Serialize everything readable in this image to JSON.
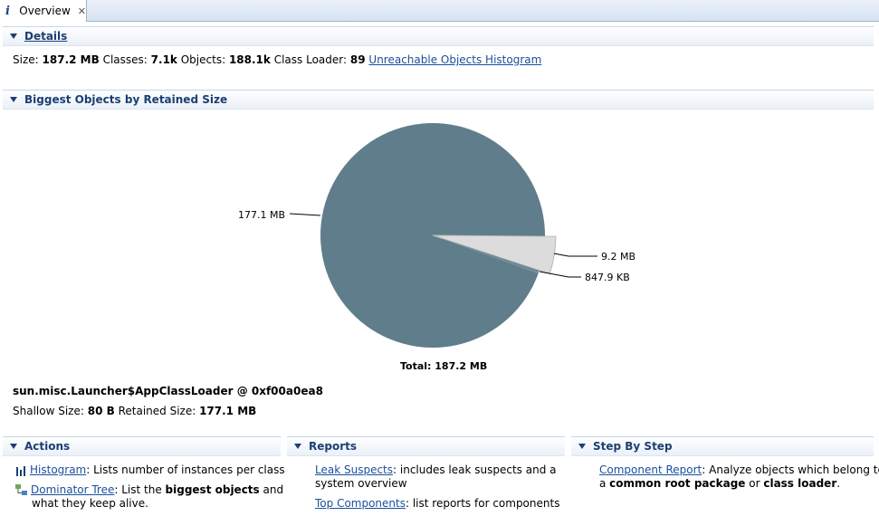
{
  "tab": {
    "title": "Overview",
    "info_glyph": "i",
    "close_glyph": "✕"
  },
  "details": {
    "header": "Details",
    "size_label": "Size:",
    "size_value": "187.2 MB",
    "classes_label": "Classes:",
    "classes_value": "7.1k",
    "objects_label": "Objects:",
    "objects_value": "188.1k",
    "classloader_label": "Class Loader:",
    "classloader_value": "89",
    "histogram_link": "Unreachable Objects Histogram"
  },
  "biggest": {
    "header": "Biggest Objects by Retained Size",
    "total_label": "Total: 187.2 MB",
    "object_name": "sun.misc.Launcher$AppClassLoader @ 0xf00a0ea8",
    "shallow_label": "Shallow Size:",
    "shallow_value": "80 B",
    "retained_label": "Retained Size:",
    "retained_value": "177.1 MB"
  },
  "chart_data": {
    "type": "pie",
    "slices": [
      {
        "label": "177.1 MB",
        "value": 177.1,
        "color": "#607d8b"
      },
      {
        "label": "9.2 MB",
        "value": 9.2,
        "color": "#dcdcdc"
      },
      {
        "label": "847.9 KB",
        "value": 0.83,
        "color": "#6f8a96"
      }
    ],
    "total_label": "Total: 187.2 MB"
  },
  "actions": {
    "header": "Actions",
    "items": [
      {
        "link": "Histogram",
        "text": ": Lists number of instances per class"
      },
      {
        "link": "Dominator Tree",
        "text_pre": ": List the ",
        "text_bold": "biggest objects",
        "text_post": " and",
        "text_line2": "what they keep alive."
      }
    ]
  },
  "reports": {
    "header": "Reports",
    "items": [
      {
        "link": "Leak Suspects",
        "text": ": includes leak suspects and a",
        "text_line2": "system overview"
      },
      {
        "link": "Top Components",
        "text": ": list reports for components"
      }
    ]
  },
  "stepbystep": {
    "header": "Step By Step",
    "link": "Component Report",
    "text": ": Analyze objects which belong to",
    "line2_pre": "a ",
    "line2_bold1": "common root package",
    "line2_mid": " or ",
    "line2_bold2": "class loader",
    "line2_post": "."
  },
  "colors": {
    "pie_main": "#607d8b",
    "link": "#1a4f9c",
    "header_text": "#1c3f73"
  }
}
